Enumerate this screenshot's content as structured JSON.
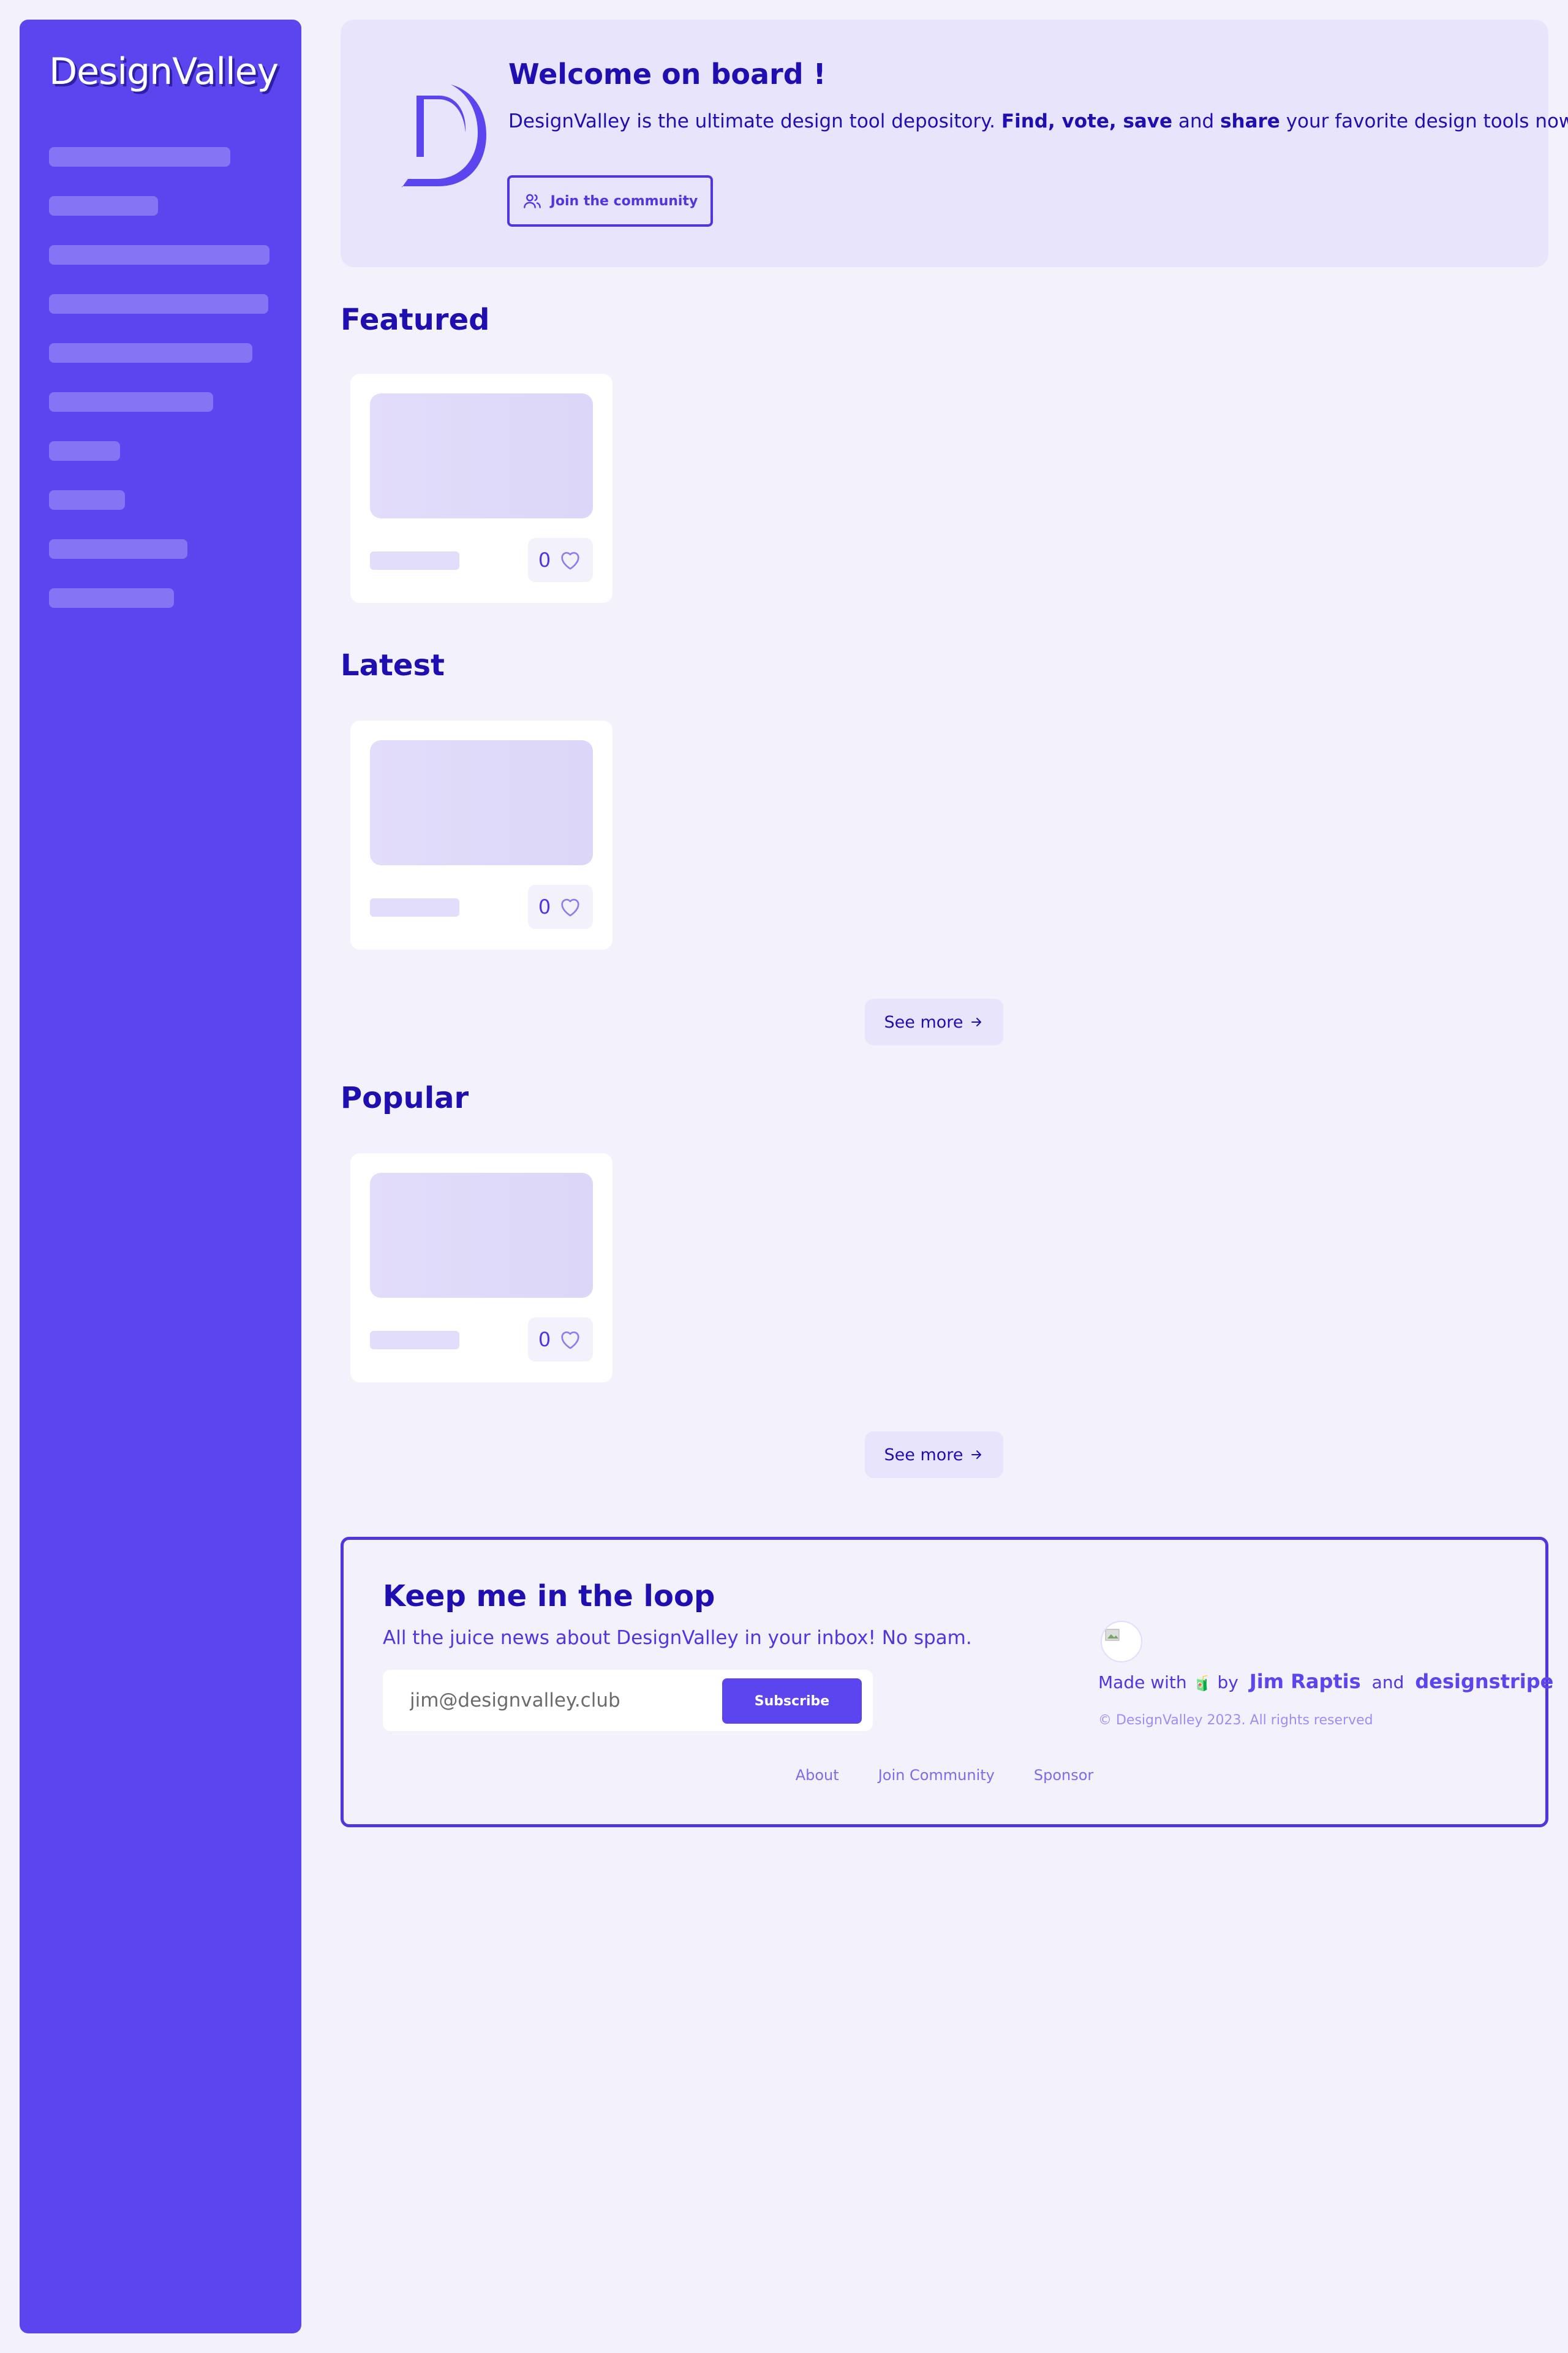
{
  "app": {
    "logo_text": "DesignValley"
  },
  "colors": {
    "primary": "#5b45ef",
    "accent_text": "#1f0fb0",
    "background": "#f3f1fc"
  },
  "hero": {
    "title": "Welcome on board !",
    "desc_1": "DesignValley is the ultimate design tool depository. ",
    "desc_2": "Find, vote, save",
    "desc_3": " and ",
    "desc_4": "share",
    "desc_5": " your favorite design tools now!",
    "join_label": "Join the community",
    "join_icon": "users-icon"
  },
  "sections": {
    "featured": {
      "title": "Featured",
      "likes": "0"
    },
    "latest": {
      "title": "Latest",
      "likes": "0",
      "see_more": "See more"
    },
    "popular": {
      "title": "Popular",
      "likes": "0",
      "see_more": "See more"
    }
  },
  "newsletter": {
    "title": "Keep me in the loop",
    "subtitle": "All the juice news about DesignValley in your inbox! No spam.",
    "email_placeholder": "jim@designvalley.club",
    "subscribe_label": "Subscribe"
  },
  "credits": {
    "made_with": "Made with",
    "emoji": "🧃",
    "by": "by",
    "author": "Jim Raptis",
    "and": "and",
    "company": "designstripe",
    "copyright": "© DesignValley 2023. All rights reserved"
  },
  "footer": {
    "links": [
      "About",
      "Join Community",
      "Sponsor"
    ]
  }
}
